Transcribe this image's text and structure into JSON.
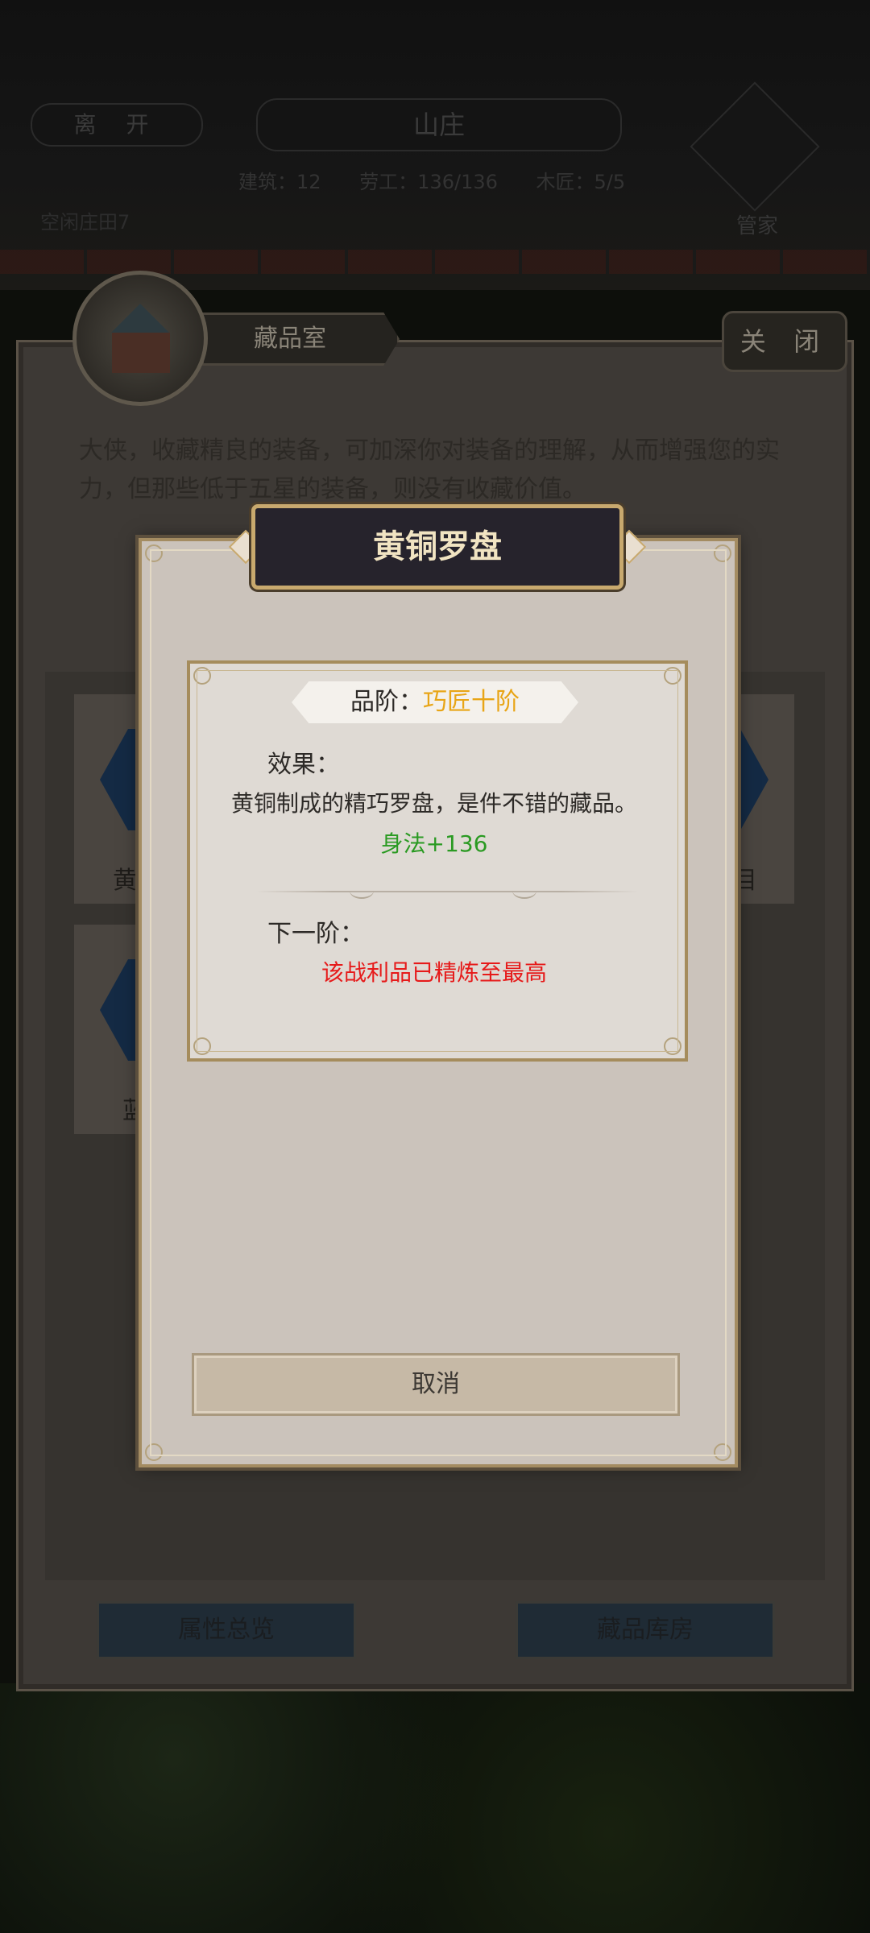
{
  "background": {
    "leave_label": "离 开",
    "title": "山庄",
    "stats": [
      "建筑：12",
      "劳工：136/136",
      "木匠：5/5"
    ],
    "steward_label": "管家",
    "left_small": "空闲庄田7"
  },
  "panel": {
    "header": "藏品室",
    "close_label": "关 闭",
    "intro": "大侠，收藏精良的装备，可加深你对装备的理解，从而增强您的实力，但那些低于五星的装备，则没有收藏价值。",
    "cards": [
      {
        "label": "黄"
      },
      {
        "label": "目"
      },
      {
        "label": "蓝"
      }
    ],
    "buttons": {
      "overview": "属性总览",
      "storage": "藏品库房"
    }
  },
  "modal": {
    "title": "黄铜罗盘",
    "grade_label": "品阶：",
    "grade_value": "巧匠十阶",
    "effect_label": "效果：",
    "effect_desc": "黄铜制成的精巧罗盘，是件不错的藏品。",
    "effect_bonus": "身法+136",
    "next_label": "下一阶：",
    "next_desc": "该战利品已精炼至最高",
    "cancel_label": "取消"
  },
  "colors": {
    "grade_value": "#e8a516",
    "bonus": "#2a9a22",
    "warning": "#e61a1a",
    "title_text": "#f1e4c2"
  }
}
